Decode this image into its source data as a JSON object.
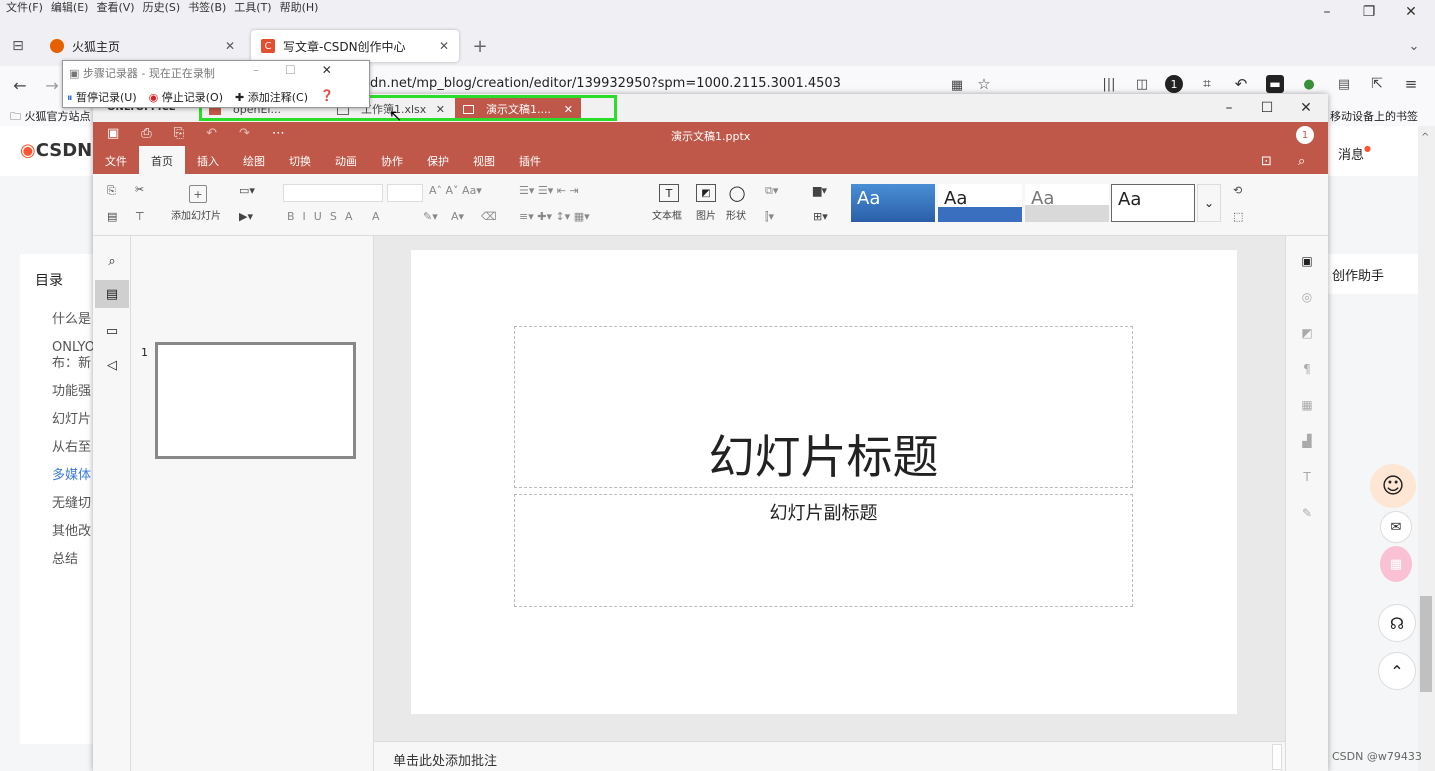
{
  "firefox": {
    "menu": [
      "文件(F)",
      "编辑(E)",
      "查看(V)",
      "历史(S)",
      "书签(B)",
      "工具(T)",
      "帮助(H)"
    ],
    "tabs": [
      {
        "label": "火狐主页"
      },
      {
        "label": "写文章-CSDN创作中心"
      }
    ],
    "url_visible": "dn.net/mp_blog/creation/editor/139932950?spm=1000.2115.3001.4503",
    "bookmarks": {
      "left": "火狐官方站点",
      "right": "移动设备上的书签"
    }
  },
  "steps_recorder": {
    "title": "步骤记录器 - 现在正在录制",
    "pause": "暂停记录(U)",
    "stop": "停止记录(O)",
    "add_comment": "添加注释(C)"
  },
  "csdn": {
    "logo": "CSDN",
    "messages": "消息",
    "toc_title": "目录",
    "toc": [
      "什么是",
      "ONLYO",
      "布：新",
      "功能强",
      "幻灯片",
      "从右至",
      "多媒体",
      "无缝切",
      "其他改",
      "总结"
    ],
    "assistant": "创作助手",
    "watermark": "CSDN @w79433"
  },
  "onlyoffice": {
    "brand": "ONLYOFFICE",
    "doc_tabs": [
      {
        "label": "openEi..."
      },
      {
        "label": "工作簿1.xlsx"
      },
      {
        "label": "演示文稿1...."
      }
    ],
    "file_title": "演示文稿1.pptx",
    "badge": "1",
    "menu": [
      "文件",
      "首页",
      "插入",
      "绘图",
      "切换",
      "动画",
      "协作",
      "保护",
      "视图",
      "插件"
    ],
    "ribbon": {
      "add_slide": "添加幻灯片",
      "textbox": "文本框",
      "image": "图片",
      "shape": "形状",
      "theme_label": "Aa"
    },
    "slide_number": "1",
    "slide_title": "幻灯片标题",
    "slide_subtitle": "幻灯片副标题",
    "notes_placeholder": "单击此处添加批注"
  }
}
